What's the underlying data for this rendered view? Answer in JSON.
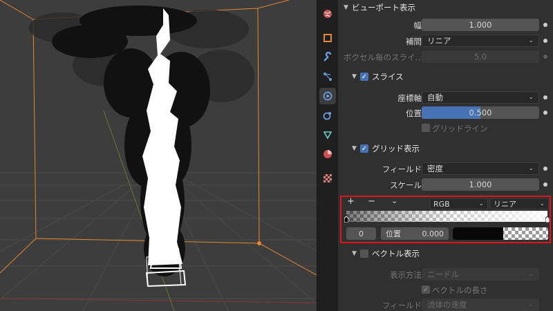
{
  "viewport_display": {
    "header": "ビューポート表示",
    "width_label": "幅",
    "width_value": "1.000",
    "interp_label": "補間",
    "interp_value": "リニア",
    "slices_label": "ボクセル毎のスライ…",
    "slices_value": "5.0"
  },
  "slice": {
    "header": "スライス",
    "axis_label": "座標軸",
    "axis_value": "自動",
    "position_label": "位置",
    "position_value": "0.500",
    "position_fraction": 0.5,
    "gridlines_label": "グリッドライン"
  },
  "grid_display": {
    "header": "グリッド表示",
    "field_label": "フィールド",
    "field_value": "密度",
    "scale_label": "スケール",
    "scale_value": "1.000"
  },
  "color_ramp": {
    "add": "+",
    "remove": "−",
    "mode": "RGB",
    "interpolation": "リニア",
    "active_index": "0",
    "position_label": "位置",
    "position_value": "0.000"
  },
  "vector_display": {
    "header": "ベクトル表示",
    "method_label": "表示方法",
    "method_value": "ニードル",
    "length_label": "ベクトルの長さ",
    "field_label": "フィールド",
    "field_value": "流体の速度"
  },
  "colors": {
    "accent": "#4772b3",
    "highlight_box": "#e0141a",
    "domain_box": "#e6892e"
  }
}
